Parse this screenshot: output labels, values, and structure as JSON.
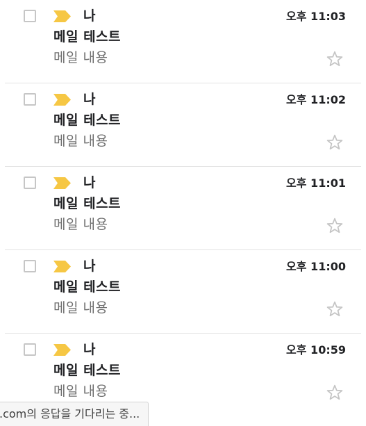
{
  "mail_list": {
    "items": [
      {
        "sender": "나",
        "subject": "메일 테스트",
        "snippet": "메일 내용",
        "time": "오후 11:03"
      },
      {
        "sender": "나",
        "subject": "메일 테스트",
        "snippet": "메일 내용",
        "time": "오후 11:02"
      },
      {
        "sender": "나",
        "subject": "메일 테스트",
        "snippet": "메일 내용",
        "time": "오후 11:01"
      },
      {
        "sender": "나",
        "subject": "메일 테스트",
        "snippet": "메일 내용",
        "time": "오후 11:00"
      },
      {
        "sender": "나",
        "subject": "메일 테스트",
        "snippet": "메일 내용",
        "time": "오후 10:59"
      }
    ],
    "importance_marker_color": "#f6c744",
    "star_icon": "star-outline-icon",
    "checkbox_checked": false
  },
  "status_bar": {
    "text": ".com의 응답을 기다리는 중..."
  }
}
